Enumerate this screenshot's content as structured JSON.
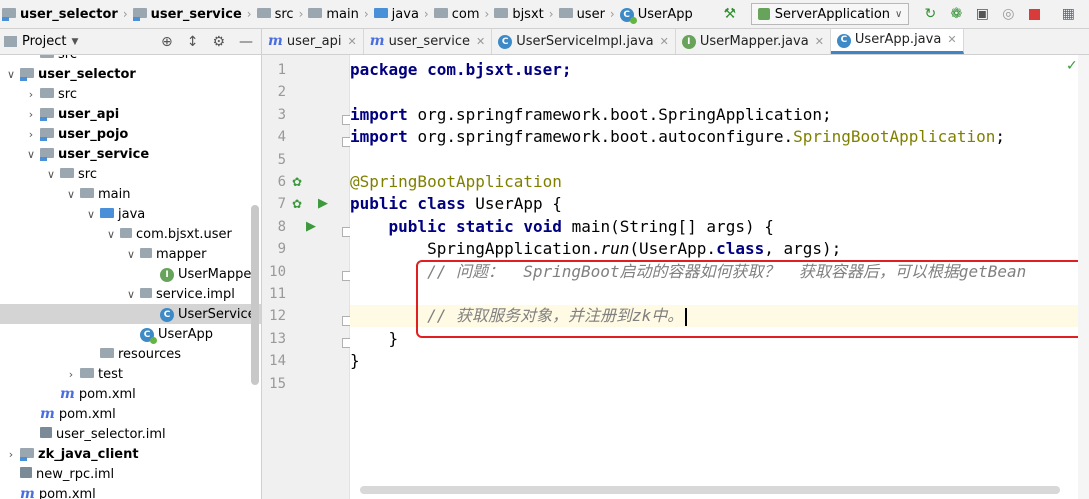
{
  "breadcrumbs": [
    "user_selector",
    "user_service",
    "src",
    "main",
    "java",
    "com",
    "bjsxt",
    "user",
    "UserApp"
  ],
  "run_config": "ServerApplication",
  "project_panel": {
    "title": "Project"
  },
  "tree": [
    {
      "label": "src",
      "depth": 1,
      "arrow": "",
      "icon": "folder"
    },
    {
      "label": "user_selector",
      "depth": 0,
      "arrow": "v",
      "icon": "module",
      "bold": true
    },
    {
      "label": "src",
      "depth": 1,
      "arrow": ">",
      "icon": "folder"
    },
    {
      "label": "user_api",
      "depth": 1,
      "arrow": ">",
      "icon": "module",
      "bold": true
    },
    {
      "label": "user_pojo",
      "depth": 1,
      "arrow": ">",
      "icon": "module",
      "bold": true
    },
    {
      "label": "user_service",
      "depth": 1,
      "arrow": "v",
      "icon": "module",
      "bold": true
    },
    {
      "label": "src",
      "depth": 2,
      "arrow": "v",
      "icon": "folder"
    },
    {
      "label": "main",
      "depth": 3,
      "arrow": "v",
      "icon": "folder"
    },
    {
      "label": "java",
      "depth": 4,
      "arrow": "v",
      "icon": "folder-blue"
    },
    {
      "label": "com.bjsxt.user",
      "depth": 5,
      "arrow": "v",
      "icon": "package"
    },
    {
      "label": "mapper",
      "depth": 6,
      "arrow": "v",
      "icon": "package"
    },
    {
      "label": "UserMappe",
      "depth": 7,
      "arrow": "",
      "icon": "interface"
    },
    {
      "label": "service.impl",
      "depth": 6,
      "arrow": "v",
      "icon": "package"
    },
    {
      "label": "UserService",
      "depth": 7,
      "arrow": "",
      "icon": "class",
      "selected": true
    },
    {
      "label": "UserApp",
      "depth": 6,
      "arrow": "",
      "icon": "app"
    },
    {
      "label": "resources",
      "depth": 4,
      "arrow": "",
      "icon": "folder"
    },
    {
      "label": "test",
      "depth": 3,
      "arrow": ">",
      "icon": "folder"
    },
    {
      "label": "pom.xml",
      "depth": 2,
      "arrow": "",
      "icon": "maven"
    },
    {
      "label": "pom.xml",
      "depth": 1,
      "arrow": "",
      "icon": "maven"
    },
    {
      "label": "user_selector.iml",
      "depth": 1,
      "arrow": "",
      "icon": "iml"
    },
    {
      "label": "zk_java_client",
      "depth": 0,
      "arrow": ">",
      "icon": "module",
      "bold": true
    },
    {
      "label": "new_rpc.iml",
      "depth": 0,
      "arrow": "",
      "icon": "iml"
    },
    {
      "label": "pom.xml",
      "depth": 0,
      "arrow": "",
      "icon": "maven"
    }
  ],
  "tabs": [
    {
      "label": "user_api",
      "icon": "maven"
    },
    {
      "label": "user_service",
      "icon": "maven"
    },
    {
      "label": "UserServiceImpl.java",
      "icon": "class"
    },
    {
      "label": "UserMapper.java",
      "icon": "interface"
    },
    {
      "label": "UserApp.java",
      "icon": "class",
      "active": true
    }
  ],
  "line_numbers": [
    "1",
    "2",
    "3",
    "4",
    "5",
    "6",
    "7",
    "8",
    "9",
    "10",
    "11",
    "12",
    "13",
    "14",
    "15"
  ],
  "code": {
    "l1": "package com.bjsxt.user;",
    "l3a": "import ",
    "l3b": "org.springframework.boot.SpringApplication;",
    "l4a": "import ",
    "l4b": "org.springframework.boot.autoconfigure.",
    "l4c": "SpringBootApplication",
    "l6": "@SpringBootApplication",
    "l7a": "public class ",
    "l7b": "UserApp {",
    "l8a": "    public static void ",
    "l8b": "main(String[] args) {",
    "l9a": "        SpringApplication.",
    "l9b": "run",
    "l9c": "(UserApp.",
    "l9d": "class",
    "l9e": ", args);",
    "l10": "        // 问题：  SpringBoot启动的容器如何获取？  获取容器后，可以根据getBean",
    "l12": "        // 获取服务对象，并注册到zk中。",
    "l13": "    }",
    "l14": "}"
  }
}
